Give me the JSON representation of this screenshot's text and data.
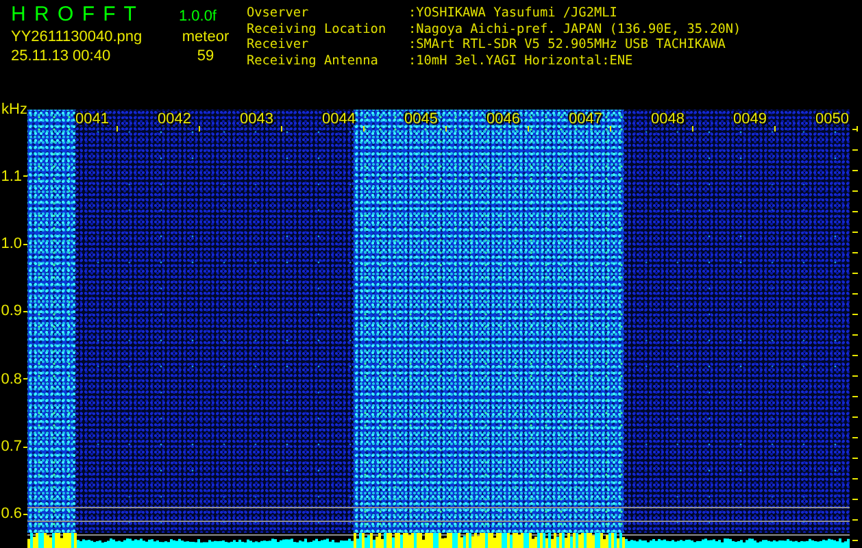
{
  "app": {
    "title": "H R O F F T",
    "version": "1.0.0f",
    "filename": "YY2611130040.png",
    "datetime": "25.11.13 00:40",
    "mode": "meteor",
    "count": "59"
  },
  "info": [
    {
      "label": "Ovserver",
      "value": ":YOSHIKAWA Yasufumi /JG2MLI"
    },
    {
      "label": "Receiving Location",
      "value": ":Nagoya Aichi-pref. JAPAN (136.90E, 35.20N)"
    },
    {
      "label": "Receiver",
      "value": ":SMArt RTL-SDR V5 52.905MHz USB TACHIKAWA"
    },
    {
      "label": "Receiving Antenna",
      "value": ":10mH 3el.YAGI Horizontal:ENE"
    }
  ],
  "spectrogram": {
    "unit": "kHz",
    "y_labels": [
      "1.1",
      "1.0",
      "0.9",
      "0.8",
      "0.7",
      "0.6"
    ],
    "time_labels": [
      "0041",
      "0042",
      "0043",
      "0044",
      "0045",
      "0046",
      "0047",
      "0048",
      "0049",
      "0050"
    ]
  }
}
